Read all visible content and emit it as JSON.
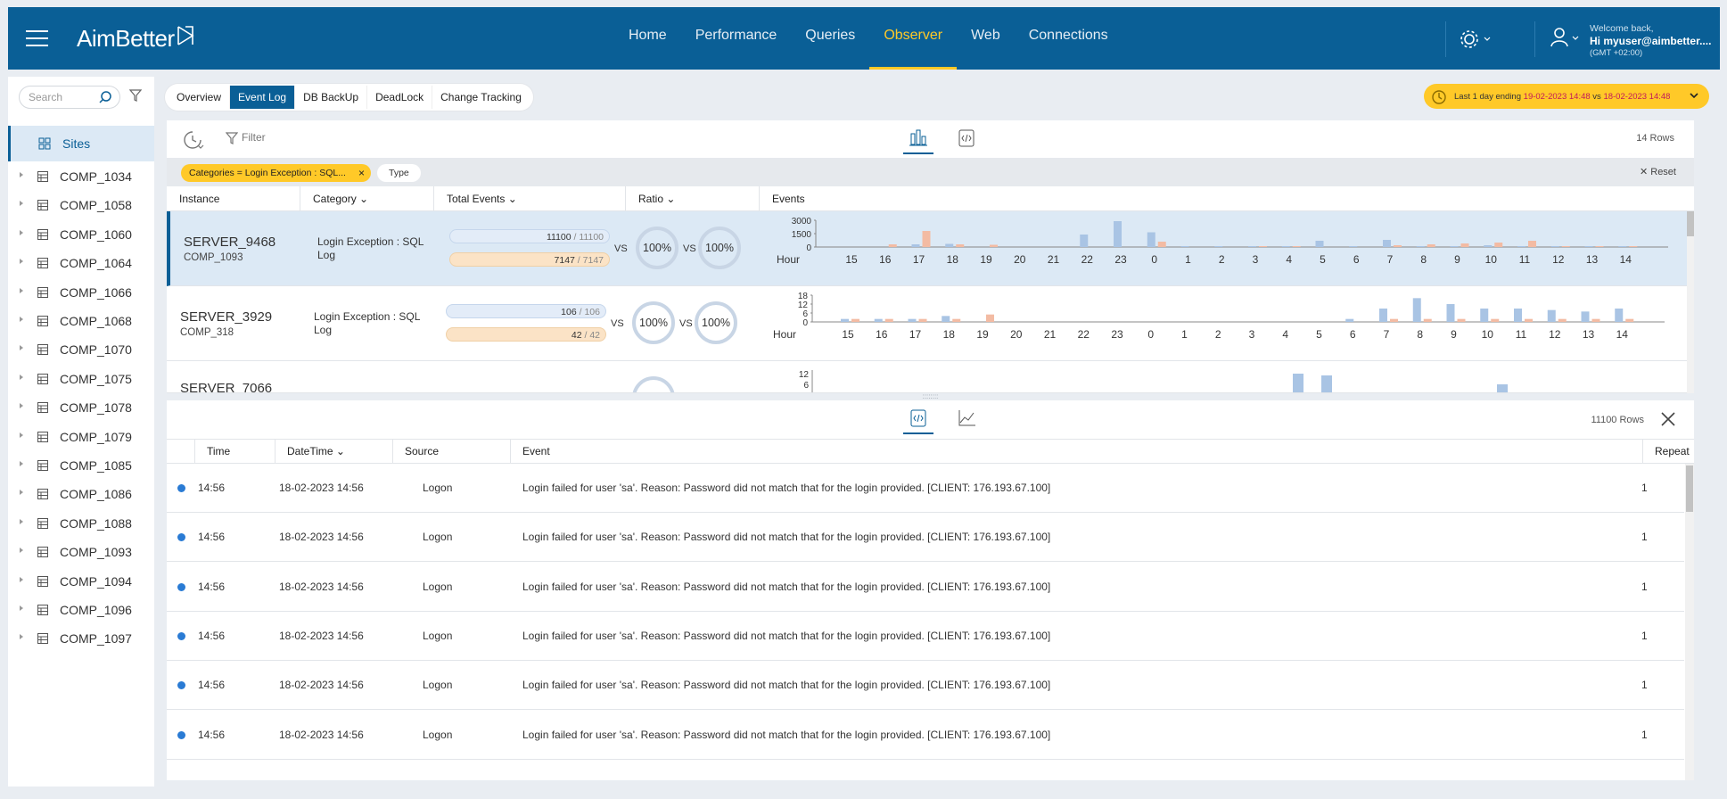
{
  "header": {
    "brand": "AimBetter",
    "nav": [
      "Home",
      "Performance",
      "Queries",
      "Observer",
      "Web",
      "Connections"
    ],
    "active_nav": "Observer",
    "welcome": "Welcome back,",
    "user": "Hi myuser@aimbetter....",
    "timezone": "(GMT +02:00)"
  },
  "sidebar": {
    "search_placeholder": "Search",
    "sites_label": "Sites",
    "items": [
      "COMP_1034",
      "COMP_1058",
      "COMP_1060",
      "COMP_1064",
      "COMP_1066",
      "COMP_1068",
      "COMP_1070",
      "COMP_1075",
      "COMP_1078",
      "COMP_1079",
      "COMP_1085",
      "COMP_1086",
      "COMP_1088",
      "COMP_1093",
      "COMP_1094",
      "COMP_1096",
      "COMP_1097"
    ]
  },
  "tabs": [
    "Overview",
    "Event Log",
    "DB BackUp",
    "DeadLock",
    "Change Tracking"
  ],
  "active_tab": "Event Log",
  "period": {
    "prefix": "Last 1 day ending ",
    "end": "19-02-2023 14:48",
    "vs": " vs ",
    "compare": "18-02-2023 14:48"
  },
  "upper": {
    "filter_label": "Filter",
    "rows_label": "14 Rows",
    "chip": "Categories = Login Exception : SQL...",
    "chip2": "Type",
    "reset": "Reset",
    "columns": [
      "Instance",
      "Category",
      "Total Events",
      "Ratio",
      "Events"
    ],
    "rows": [
      {
        "server": "SERVER_9468",
        "comp": "COMP_1093",
        "category": "Login Exception : SQL Log",
        "total1": "11100",
        "total1b": "11100",
        "total2": "7147",
        "total2b": "7147",
        "ratio1": "100%",
        "ratio2": "100%",
        "yticks": [
          "3000",
          "1500",
          "0"
        ]
      },
      {
        "server": "SERVER_3929",
        "comp": "COMP_318",
        "category": "Login Exception : SQL Log",
        "total1": "106",
        "total1b": "106",
        "total2": "42",
        "total2b": "42",
        "ratio1": "100%",
        "ratio2": "100%",
        "yticks": [
          "18",
          "12",
          "6",
          "0"
        ]
      },
      {
        "server": "SERVER_7066",
        "yticks": [
          "12",
          "6"
        ]
      }
    ],
    "vs": "VS",
    "hour_label": "Hour",
    "hours": [
      "15",
      "16",
      "17",
      "18",
      "19",
      "20",
      "21",
      "22",
      "23",
      "0",
      "1",
      "2",
      "3",
      "4",
      "5",
      "6",
      "7",
      "8",
      "9",
      "10",
      "11",
      "12",
      "13",
      "14"
    ],
    "series_colors": {
      "current": "#a9c4e4",
      "previous": "#f3bba3"
    }
  },
  "lower": {
    "rows_label": "11100 Rows",
    "columns": [
      "Time",
      "DateTime",
      "Source",
      "Event",
      "Repeat"
    ],
    "rows": [
      {
        "time": "14:56",
        "datetime": "18-02-2023 14:56",
        "source": "Logon",
        "event": "Login failed for user 'sa'. Reason: Password did not match that for the login provided. [CLIENT: 176.193.67.100]",
        "repeat": "1"
      },
      {
        "time": "14:56",
        "datetime": "18-02-2023 14:56",
        "source": "Logon",
        "event": "Login failed for user 'sa'. Reason: Password did not match that for the login provided. [CLIENT: 176.193.67.100]",
        "repeat": "1"
      },
      {
        "time": "14:56",
        "datetime": "18-02-2023 14:56",
        "source": "Logon",
        "event": "Login failed for user 'sa'. Reason: Password did not match that for the login provided. [CLIENT: 176.193.67.100]",
        "repeat": "1"
      },
      {
        "time": "14:56",
        "datetime": "18-02-2023 14:56",
        "source": "Logon",
        "event": "Login failed for user 'sa'. Reason: Password did not match that for the login provided. [CLIENT: 176.193.67.100]",
        "repeat": "1"
      },
      {
        "time": "14:56",
        "datetime": "18-02-2023 14:56",
        "source": "Logon",
        "event": "Login failed for user 'sa'. Reason: Password did not match that for the login provided. [CLIENT: 176.193.67.100]",
        "repeat": "1"
      },
      {
        "time": "14:56",
        "datetime": "18-02-2023 14:56",
        "source": "Logon",
        "event": "Login failed for user 'sa'. Reason: Password did not match that for the login provided. [CLIENT: 176.193.67.100]",
        "repeat": "1"
      }
    ]
  },
  "chart_data": [
    {
      "type": "bar",
      "categories": [
        "15",
        "16",
        "17",
        "18",
        "19",
        "20",
        "21",
        "22",
        "23",
        "0",
        "1",
        "2",
        "3",
        "4",
        "5",
        "6",
        "7",
        "8",
        "9",
        "10",
        "11",
        "12",
        "13",
        "14"
      ],
      "xlabel": "Hour",
      "ylim": [
        0,
        3000
      ],
      "series": [
        {
          "values": [
            0,
            0,
            300,
            350,
            0,
            0,
            0,
            1400,
            2900,
            1650,
            50,
            80,
            40,
            100,
            700,
            80,
            800,
            80,
            100,
            200,
            60,
            80,
            60,
            80
          ]
        },
        {
          "values": [
            0,
            300,
            1800,
            300,
            250,
            0,
            0,
            0,
            0,
            600,
            0,
            0,
            80,
            80,
            0,
            0,
            200,
            300,
            400,
            500,
            700,
            100,
            100,
            100
          ]
        }
      ]
    },
    {
      "type": "bar",
      "categories": [
        "15",
        "16",
        "17",
        "18",
        "19",
        "20",
        "21",
        "22",
        "23",
        "0",
        "1",
        "2",
        "3",
        "4",
        "5",
        "6",
        "7",
        "8",
        "9",
        "10",
        "11",
        "12",
        "13",
        "14"
      ],
      "xlabel": "Hour",
      "ylim": [
        0,
        18
      ],
      "series": [
        {
          "values": [
            2,
            2,
            2,
            4,
            0,
            0,
            0,
            0,
            0,
            0,
            0,
            0,
            0,
            0,
            0,
            2,
            9,
            16,
            12,
            9,
            9,
            8,
            7,
            9
          ]
        },
        {
          "values": [
            2,
            2,
            2,
            2,
            5,
            0,
            0,
            0,
            0,
            0,
            0,
            0,
            0,
            0,
            0,
            0,
            2,
            2,
            2,
            2,
            2,
            2,
            2,
            2
          ]
        }
      ]
    }
  ]
}
